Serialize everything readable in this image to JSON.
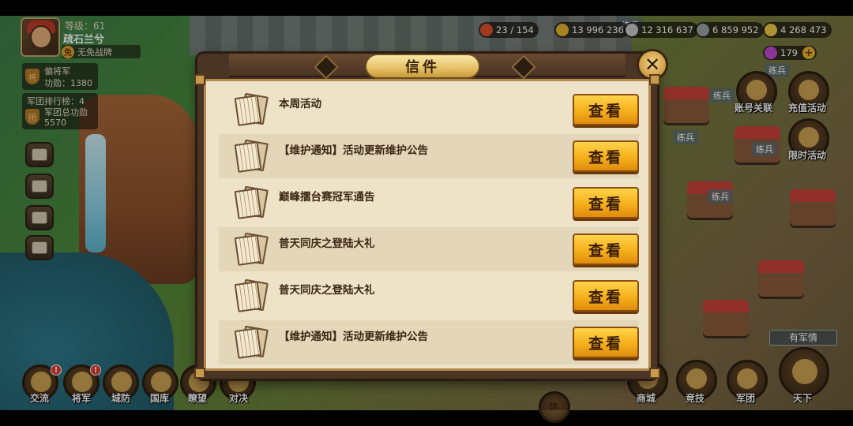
{
  "player": {
    "level": "等级：61",
    "name": "疏石兰兮",
    "no_war_label": "无免战牌",
    "no_war_icon": "shield-icon",
    "rank_title": "偏将军",
    "merit_label": "功勋：1380",
    "legion_rank_label": "军团排行榜：4",
    "legion_merit_label": "军团总功勋",
    "legion_merit_value": "5570"
  },
  "resources": [
    {
      "name": "stamina",
      "icon": "meat-icon",
      "color": "#e0532c",
      "value": "23 / 154"
    },
    {
      "name": "gold",
      "icon": "coin-icon",
      "color": "#e8b52a",
      "value": "13 996 236"
    },
    {
      "name": "food",
      "icon": "grain-icon",
      "color": "#c9c9c9",
      "value": "12 316 637"
    },
    {
      "name": "iron",
      "icon": "iron-icon",
      "color": "#9aa2a8",
      "value": "6 859 952"
    },
    {
      "name": "ingot",
      "icon": "ingot-icon",
      "color": "#f1c84a",
      "value": "4 268 473"
    }
  ],
  "gems": {
    "value": "179",
    "plus_label": "+"
  },
  "right_buttons": {
    "account_link": "账号关联",
    "recharge_event": "充值活动",
    "limited_event": "限时活动"
  },
  "bottom_nav": {
    "left": [
      {
        "label": "交流",
        "icon": "chat-icon",
        "alert": "!"
      },
      {
        "label": "将军",
        "icon": "general-icon",
        "alert": "!"
      },
      {
        "label": "城防",
        "icon": "defense-icon"
      },
      {
        "label": "国库",
        "icon": "treasury-icon"
      },
      {
        "label": "瞭望",
        "icon": "watchtower-icon"
      },
      {
        "label": "对决",
        "icon": "duel-icon"
      }
    ],
    "right": [
      {
        "label": "商城",
        "icon": "shop-icon"
      },
      {
        "label": "竞技",
        "icon": "arena-icon"
      },
      {
        "label": "军团",
        "icon": "legion-icon"
      },
      {
        "label": "天下",
        "icon": "world-icon"
      }
    ],
    "rest_label": "休"
  },
  "map_labels": [
    "练兵",
    "练兵",
    "练兵",
    "练兵",
    "练兵",
    "练兵"
  ],
  "army_status": "有军情",
  "dialog": {
    "title": "信件",
    "close_icon": "close-icon",
    "view_label": "查看",
    "letters": [
      {
        "title": "本周活动"
      },
      {
        "title": "【维护通知】活动更新维护公告"
      },
      {
        "title": "巅峰擂台赛冠军通告"
      },
      {
        "title": "普天同庆之登陆大礼"
      },
      {
        "title": "普天同庆之登陆大礼"
      },
      {
        "title": "【维护通知】活动更新维护公告"
      }
    ]
  },
  "colors": {
    "button_gold": "#f5b01c",
    "panel_parchment": "#eee2c8",
    "frame_brown": "#4a3423",
    "alert_red": "#e23a2f"
  }
}
